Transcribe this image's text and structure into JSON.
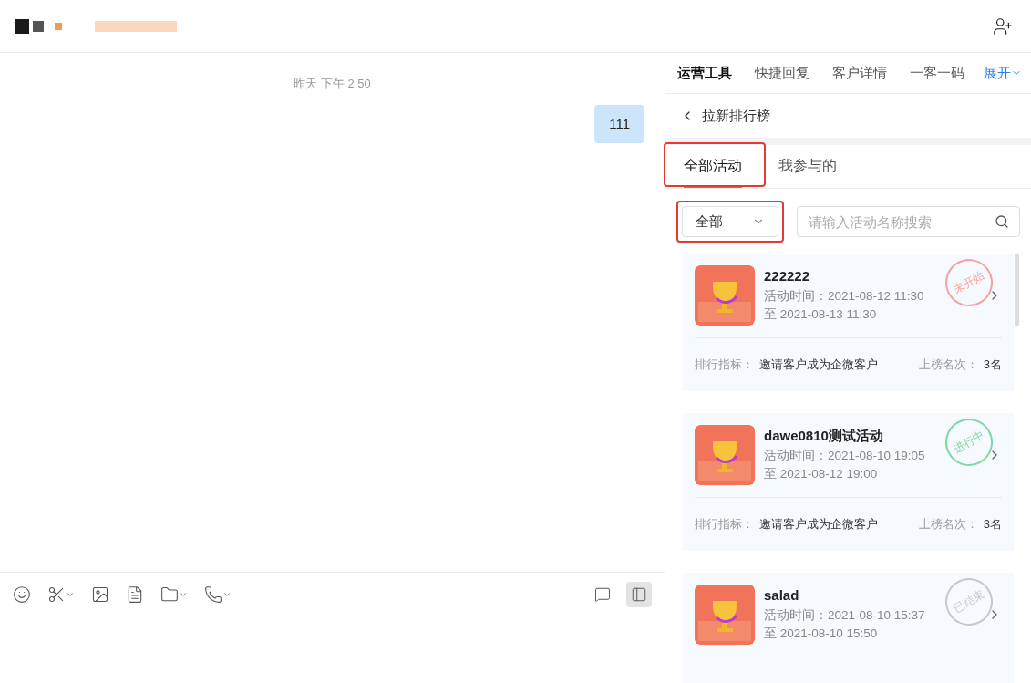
{
  "chat": {
    "timestamp": "昨天 下午 2:50",
    "messages": [
      {
        "text": "111",
        "outgoing": true
      }
    ]
  },
  "toolbar": {
    "items": [
      {
        "kind": "emoji",
        "caret": false
      },
      {
        "kind": "scissors",
        "caret": true
      },
      {
        "kind": "image",
        "caret": false
      },
      {
        "kind": "document",
        "caret": false
      },
      {
        "kind": "folder",
        "caret": true
      },
      {
        "kind": "phone",
        "caret": true
      }
    ],
    "right": [
      {
        "kind": "chat-history",
        "selected": false
      },
      {
        "kind": "sidebar",
        "selected": true
      }
    ]
  },
  "panel": {
    "tabs": [
      {
        "label": "运营工具",
        "selected": true
      },
      {
        "label": "快捷回复",
        "selected": false
      },
      {
        "label": "客户详情",
        "selected": false
      },
      {
        "label": "一客一码",
        "selected": false
      }
    ],
    "expand": "展开",
    "back": "拉新排行榜",
    "subtabs": [
      {
        "label": "全部活动",
        "selected": true,
        "highlighted": true
      },
      {
        "label": "我参与的",
        "selected": false,
        "highlighted": false
      }
    ],
    "filter": {
      "value": "全部",
      "highlighted": true
    },
    "search": {
      "placeholder": "请输入活动名称搜索"
    },
    "activities": [
      {
        "name": "222222",
        "time_label": "活动时间：",
        "start": "2021-08-12 11:30",
        "end": "至 2021-08-13 11:30",
        "stamp": "未开始",
        "color": "#f4a3a0",
        "metric_label": "排行指标：",
        "metric": "邀请客户成为企微客户",
        "rank_label": "上榜名次：",
        "rank": "3名"
      },
      {
        "name": "dawe0810测试活动",
        "time_label": "活动时间：",
        "start": "2021-08-10 19:05",
        "end": "至 2021-08-12 19:00",
        "stamp": "进行中",
        "color": "#7fd9a4",
        "metric_label": "排行指标：",
        "metric": "邀请客户成为企微客户",
        "rank_label": "上榜名次：",
        "rank": "3名"
      },
      {
        "name": "salad",
        "time_label": "活动时间：",
        "start": "2021-08-10 15:37",
        "end": "至 2021-08-10 15:50",
        "stamp": "已结束",
        "color": "#c8c8c8"
      }
    ]
  }
}
